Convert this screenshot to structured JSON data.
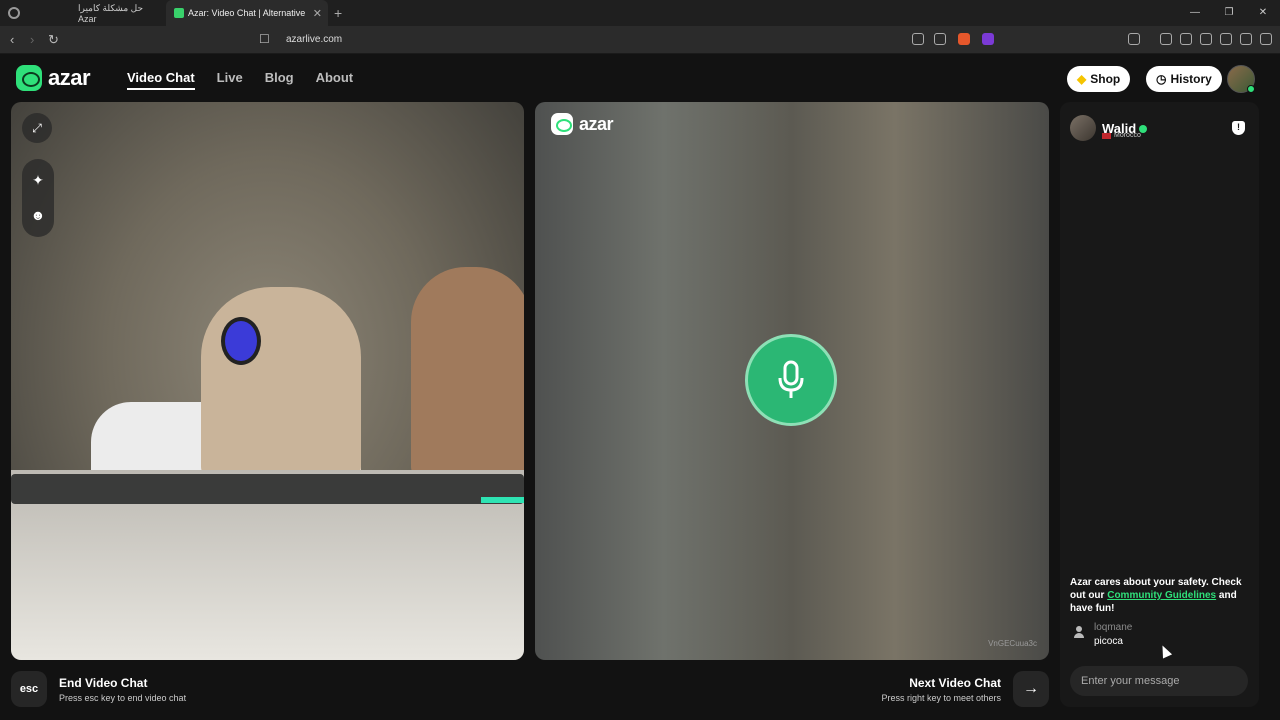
{
  "browser": {
    "tabs": [
      {
        "label": "حل مشكلة كاميرا Azar"
      },
      {
        "label": "Azar: Video Chat | Alternative",
        "close": "✕"
      }
    ],
    "new_tab": "+",
    "window_controls": [
      "—",
      "❐",
      "✕"
    ],
    "url": "azarlive.com",
    "nav": {
      "back": "‹",
      "forward": "›",
      "reload": "↻",
      "bookmark": "☐"
    }
  },
  "header": {
    "logo_text": "azar",
    "nav": [
      "Video Chat",
      "Live",
      "Blog",
      "About"
    ],
    "shop_label": "Shop",
    "history_label": "History"
  },
  "video": {
    "watermark": "azar",
    "video_id": "VnGECuua3c",
    "tools": {
      "expand": "⤢",
      "sparkle": "✦",
      "face": "☻"
    }
  },
  "chat": {
    "partner_name": "Walid",
    "partner_country": "Morocco",
    "safety_prefix": "Azar cares about your safety. Check out our ",
    "safety_link": "Community Guidelines",
    "safety_suffix": " and have fun!",
    "message_user": "loqmane",
    "message_text": "picoca",
    "input_placeholder": "Enter your message"
  },
  "footer": {
    "esc_key": "esc",
    "end_title": "End Video Chat",
    "end_sub": "Press esc key to end video chat",
    "next_title": "Next Video Chat",
    "next_sub": "Press right key to meet others",
    "next_arrow": "→"
  },
  "colors": {
    "accent": "#2fe07a",
    "background": "#121212",
    "panel": "#181818"
  }
}
